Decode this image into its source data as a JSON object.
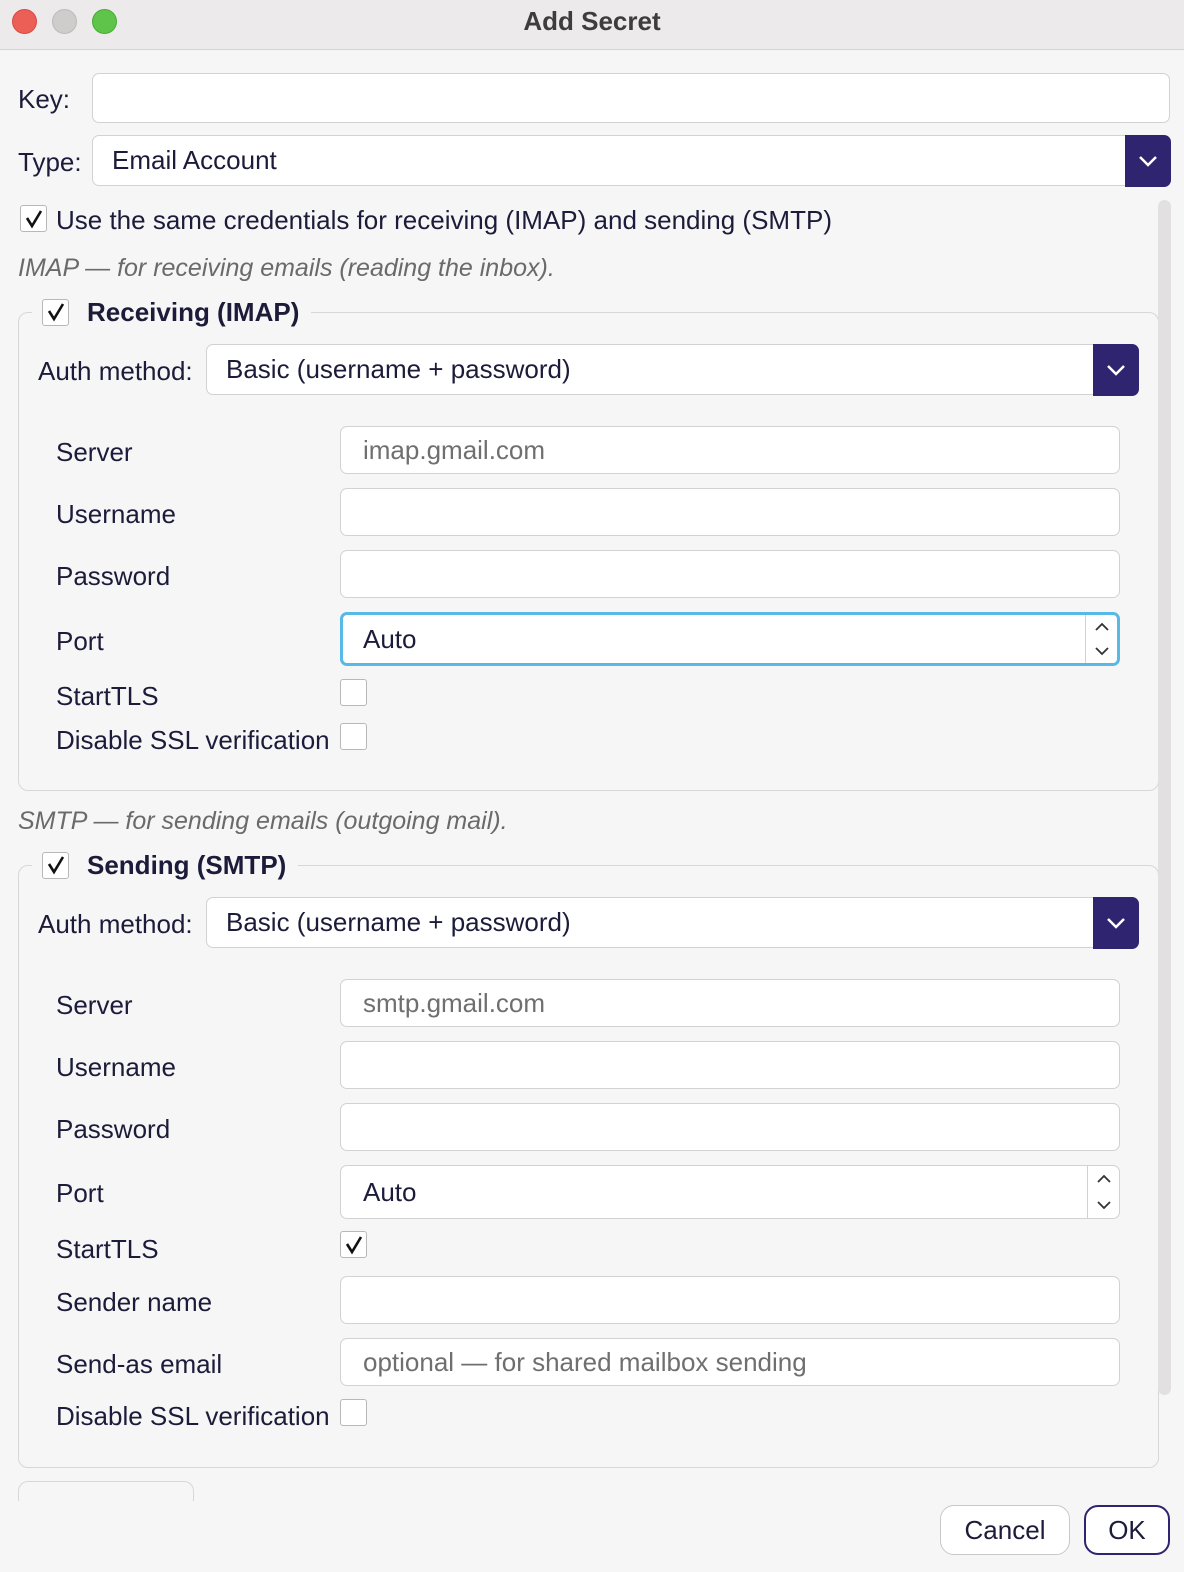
{
  "window": {
    "title": "Add Secret"
  },
  "key": {
    "label": "Key:",
    "value": ""
  },
  "type": {
    "label": "Type:",
    "value": "Email Account"
  },
  "same_credentials": {
    "label": "Use the same credentials for receiving (IMAP) and sending (SMTP)",
    "checked": true
  },
  "imap": {
    "hint": "IMAP — for receiving emails (reading the inbox).",
    "group_title": "Receiving (IMAP)",
    "enabled": true,
    "auth_label": "Auth method:",
    "auth_value": "Basic (username + password)",
    "server_label": "Server",
    "server_placeholder": "imap.gmail.com",
    "username_label": "Username",
    "password_label": "Password",
    "port_label": "Port",
    "port_value": "Auto",
    "starttls_label": "StartTLS",
    "starttls_checked": false,
    "disable_ssl_label": "Disable SSL verification",
    "disable_ssl_checked": false
  },
  "smtp": {
    "hint": "SMTP — for sending emails (outgoing mail).",
    "group_title": "Sending (SMTP)",
    "enabled": true,
    "auth_label": "Auth method:",
    "auth_value": "Basic (username + password)",
    "server_label": "Server",
    "server_placeholder": "smtp.gmail.com",
    "username_label": "Username",
    "password_label": "Password",
    "port_label": "Port",
    "port_value": "Auto",
    "starttls_label": "StartTLS",
    "starttls_checked": true,
    "sender_name_label": "Sender name",
    "send_as_label": "Send-as email",
    "send_as_placeholder": "optional — for shared mailbox sending",
    "disable_ssl_label": "Disable SSL verification",
    "disable_ssl_checked": false
  },
  "buttons": {
    "cancel": "Cancel",
    "ok": "OK"
  },
  "colors": {
    "accent": "#2e2470",
    "focus_ring": "#58b8e6"
  }
}
